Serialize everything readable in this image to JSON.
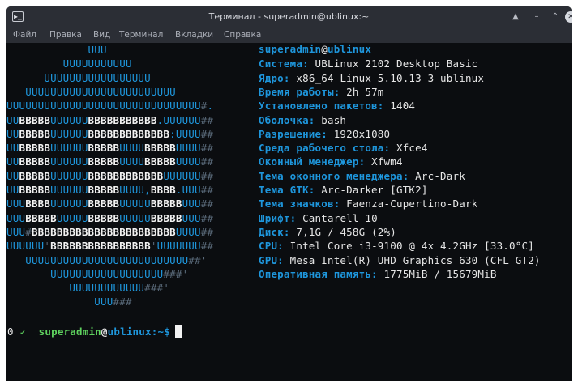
{
  "window": {
    "title": "Терминал - superadmin@ublinux:~",
    "app_icon_glyph": "▶_",
    "buttons": {
      "up": "▲",
      "minimize": "–",
      "maximize": "⌃",
      "close": "✕"
    }
  },
  "menu": [
    "Файл",
    "Правка",
    "Вид",
    "Терминал",
    "Вкладки",
    "Справка"
  ],
  "logo_lines": [
    "             UUU",
    "         UUUUUUUUUUU",
    "      UUUUUUUUUUUUUUUUU",
    "   UUUUUUUUUUUUUUUUUUUUUUUU",
    "UUUUUUUUUUUUUUUUUUUUUUUUUUUUUUU#.",
    "UUBBBBBUUUUUUBBBBBBBBBBB.UUUUUU##",
    "UUBBBBBUUUUUUBBBBBBBBBBBBB:UUUU##",
    "UUBBBBBUUUUUUBBBBBUUUUBBBBBUUUU##",
    "UUBBBBBUUUUUUBBBBBUUUUBBBBBUUUU##",
    "UUBBBBBUUUUUUBBBBBBBBBBBBUUUUUU##",
    "UUBBBBBUUUUUUBBBBBUUUU,BBBB.UUU##",
    "UUUBBBBUUUUUUBBBBBUUUUUBBBBBUUU##",
    "UUUBBBBBUUUUUBBBBBUUUUUBBBBBUUU##",
    "UUU#BBBBBBBBBBBBBBBBBBBBBBBUUUU##",
    "UUUUUU'BBBBBBBBBBBBBBBB'UUUUUUU##",
    "   UUUUUUUUUUUUUUUUUUUUUUUUUU##'",
    "       UUUUUUUUUUUUUUUUUU###'",
    "          UUUUUUUUUUUU###'",
    "              UUU###'"
  ],
  "info": {
    "user": "superadmin",
    "at": "@",
    "host": "ublinux",
    "separator": "-----------------",
    "rows": [
      {
        "key": "Система:",
        "value": " UBLinux 2102 Desktop Basic"
      },
      {
        "key": "Ядро:",
        "value": " x86_64 Linux 5.10.13-3-ublinux"
      },
      {
        "key": "Время работы:",
        "value": " 2h 57m"
      },
      {
        "key": "Установлено пакетов:",
        "value": " 1404"
      },
      {
        "key": "Оболочка:",
        "value": " bash"
      },
      {
        "key": "Разрешение:",
        "value": " 1920x1080"
      },
      {
        "key": "Среда рабочего стола:",
        "value": " Xfce4"
      },
      {
        "key": "Оконный менеджер:",
        "value": " Xfwm4"
      },
      {
        "key": "Тема оконного менеджера:",
        "value": " Arc-Dark"
      },
      {
        "key": "Тема GTK:",
        "value": " Arc-Darker [GTK2]"
      },
      {
        "key": "Тема значков:",
        "value": " Faenza-Cupertino-Dark"
      },
      {
        "key": "Шрифт:",
        "value": " Cantarell 10"
      },
      {
        "key": "Диск:",
        "value": " 7,1G / 458G (2%)"
      },
      {
        "key": "CPU:",
        "value": " Intel Core i3-9100 @ 4x 4.2GHz [33.0°C]"
      },
      {
        "key": "GPU:",
        "value": " Mesa Intel(R) UHD Graphics 630 (CFL GT2)"
      },
      {
        "key": "Оперативная память:",
        "value": " 1775MiB / 15679MiB"
      }
    ]
  },
  "prompt": {
    "status": "0",
    "check": "✓",
    "user": "superadmin",
    "at": "@",
    "host": "ublinux",
    "path": ":~",
    "symbol": "$"
  },
  "colors": {
    "accent": "#1e96dc",
    "background": "#0b0d10",
    "titlebar": "#2b2e35",
    "prompt_user": "#5fd35f"
  }
}
